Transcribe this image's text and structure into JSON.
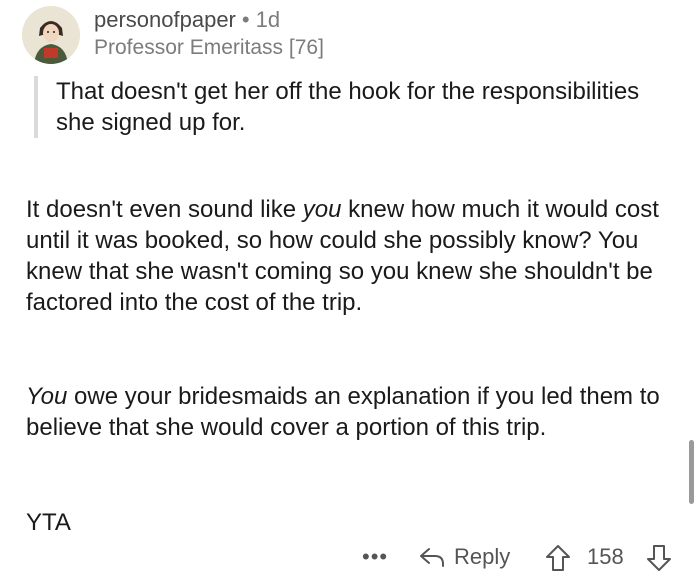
{
  "comment": {
    "username": "personofpaper",
    "separator": "•",
    "age": "1d",
    "flair": "Professor Emeritass [76]",
    "quote": "That doesn't get her off the hook for the responsibilities she signed up for.",
    "p1_a": "It doesn't even sound like ",
    "p1_em": "you",
    "p1_b": " knew how much it would cost until it was booked, so how could she possibly know? You knew that she wasn't coming so you knew she shouldn't be factored into the cost of the trip.",
    "p2_em": "You",
    "p2_b": " owe your bridesmaids an explanation if you led them to believe that she would cover a portion of this trip.",
    "p3": "YTA"
  },
  "actions": {
    "more": "•••",
    "reply_label": "Reply",
    "score": "158"
  },
  "icons": {
    "avatar": "user-avatar",
    "reply": "reply-arrow-icon",
    "upvote": "upvote-arrow-icon",
    "downvote": "downvote-arrow-icon"
  }
}
